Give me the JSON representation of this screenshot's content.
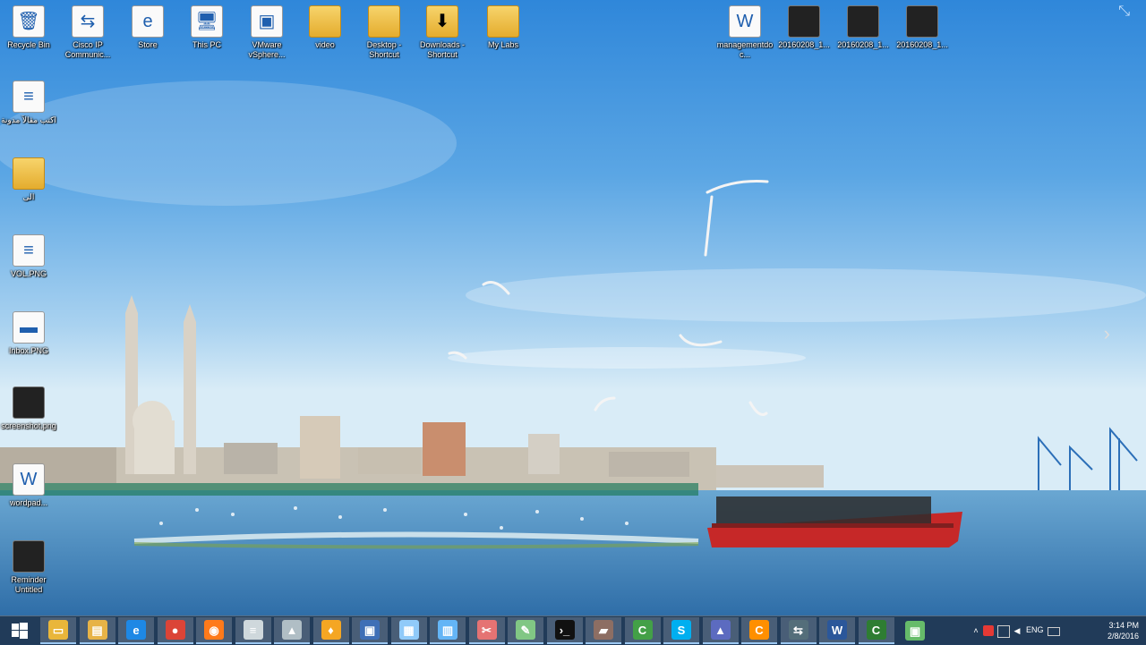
{
  "desktop": {
    "icons_top": [
      {
        "label": "Recycle Bin",
        "glyph": "🗑",
        "kind": "doc",
        "icon_name": "recycle-bin-icon"
      },
      {
        "label": "Cisco IP Communic...",
        "glyph": "⇆",
        "kind": "doc",
        "icon_name": "cisco-ip-communicator-icon"
      },
      {
        "label": "Store",
        "glyph": "e",
        "kind": "doc",
        "icon_name": "store-icon"
      },
      {
        "label": "This PC",
        "glyph": "🖥",
        "kind": "doc",
        "icon_name": "this-pc-icon"
      },
      {
        "label": "VMware vSphere...",
        "glyph": "▣",
        "kind": "doc",
        "icon_name": "vmware-vsphere-icon"
      },
      {
        "label": "video",
        "glyph": "",
        "kind": "folder",
        "icon_name": "folder-icon"
      },
      {
        "label": "Desktop - Shortcut",
        "glyph": "",
        "kind": "folder",
        "icon_name": "folder-shortcut-icon"
      },
      {
        "label": "Downloads - Shortcut",
        "glyph": "⬇",
        "kind": "folder",
        "icon_name": "downloads-shortcut-icon"
      },
      {
        "label": "My Labs",
        "glyph": "",
        "kind": "folder",
        "icon_name": "folder-icon"
      }
    ],
    "icons_top_right": [
      {
        "label": "managementdoc...",
        "glyph": "W",
        "kind": "doc",
        "icon_name": "word-document-icon"
      },
      {
        "label": "20160208_1...",
        "glyph": "",
        "kind": "thumb",
        "icon_name": "video-file-icon"
      },
      {
        "label": "20160208_1...",
        "glyph": "",
        "kind": "thumb",
        "icon_name": "video-file-icon"
      },
      {
        "label": "20160208_1...",
        "glyph": "",
        "kind": "thumb",
        "icon_name": "video-file-icon"
      }
    ],
    "icons_left": [
      {
        "label": "اكتب مقالاً مدونة",
        "glyph": "≡",
        "kind": "doc",
        "icon_name": "document-icon"
      },
      {
        "label": "الى",
        "glyph": "",
        "kind": "folder",
        "icon_name": "folder-icon"
      },
      {
        "label": "VOL.PNG",
        "glyph": "≡",
        "kind": "doc",
        "icon_name": "image-file-icon"
      },
      {
        "label": "Inbox.PNG",
        "glyph": "▬",
        "kind": "doc",
        "icon_name": "image-file-icon"
      },
      {
        "label": "screenshot.png",
        "glyph": "",
        "kind": "thumb",
        "icon_name": "image-file-icon"
      },
      {
        "label": "wordpad...",
        "glyph": "W",
        "kind": "doc",
        "icon_name": "word-document-icon"
      },
      {
        "label": "Reminder Untitled",
        "glyph": "",
        "kind": "thumb",
        "icon_name": "video-file-icon"
      }
    ]
  },
  "taskbar": {
    "start_icon": "windows-start-icon",
    "buttons": [
      {
        "name": "file-explorer-icon",
        "glyph": "▭",
        "color": "#e9b63a"
      },
      {
        "name": "folder-icon",
        "glyph": "▤",
        "color": "#e7b347"
      },
      {
        "name": "internet-explorer-icon",
        "glyph": "e",
        "color": "#1e88e5"
      },
      {
        "name": "chrome-icon",
        "glyph": "●",
        "color": "#db4437"
      },
      {
        "name": "firefox-icon",
        "glyph": "◉",
        "color": "#ff7a1a"
      },
      {
        "name": "notepad-icon",
        "glyph": "≡",
        "color": "#cfd8dc"
      },
      {
        "name": "network-icon",
        "glyph": "▲",
        "color": "#b0bec5"
      },
      {
        "name": "paint-icon",
        "glyph": "♦",
        "color": "#f5a623"
      },
      {
        "name": "remote-desktop-icon",
        "glyph": "▣",
        "color": "#3f6fb6"
      },
      {
        "name": "calculator-icon",
        "glyph": "▦",
        "color": "#90caf9"
      },
      {
        "name": "terminal-server-icon",
        "glyph": "▥",
        "color": "#64b5f6"
      },
      {
        "name": "snipping-tool-icon",
        "glyph": "✂",
        "color": "#e57373"
      },
      {
        "name": "paint-brush-icon",
        "glyph": "✎",
        "color": "#81c784"
      },
      {
        "name": "command-prompt-icon",
        "glyph": "›_",
        "color": "#111111"
      },
      {
        "name": "video-editor-icon",
        "glyph": "▰",
        "color": "#8d6e63"
      },
      {
        "name": "camtasia-icon",
        "glyph": "C",
        "color": "#43a047"
      },
      {
        "name": "skype-icon",
        "glyph": "S",
        "color": "#00aff0"
      },
      {
        "name": "computer-network-icon",
        "glyph": "▲",
        "color": "#5c6bc0"
      },
      {
        "name": "recorder-icon",
        "glyph": "C",
        "color": "#ff8f00"
      },
      {
        "name": "cisco-phone-icon",
        "glyph": "⇆",
        "color": "#546e7a"
      },
      {
        "name": "word-icon",
        "glyph": "W",
        "color": "#2b579a"
      },
      {
        "name": "camtasia-recorder-icon",
        "glyph": "C",
        "color": "#2e7d32"
      },
      {
        "name": "vsphere-client-icon",
        "glyph": "▣",
        "color": "#66bb6a"
      }
    ],
    "tray": {
      "expand_glyph": "˄",
      "icons": [
        "flag-icon",
        "network-status-icon",
        "volume-icon",
        "battery-icon"
      ],
      "language": "ENG",
      "time": "3:14 PM",
      "date": "2/8/2016"
    }
  }
}
